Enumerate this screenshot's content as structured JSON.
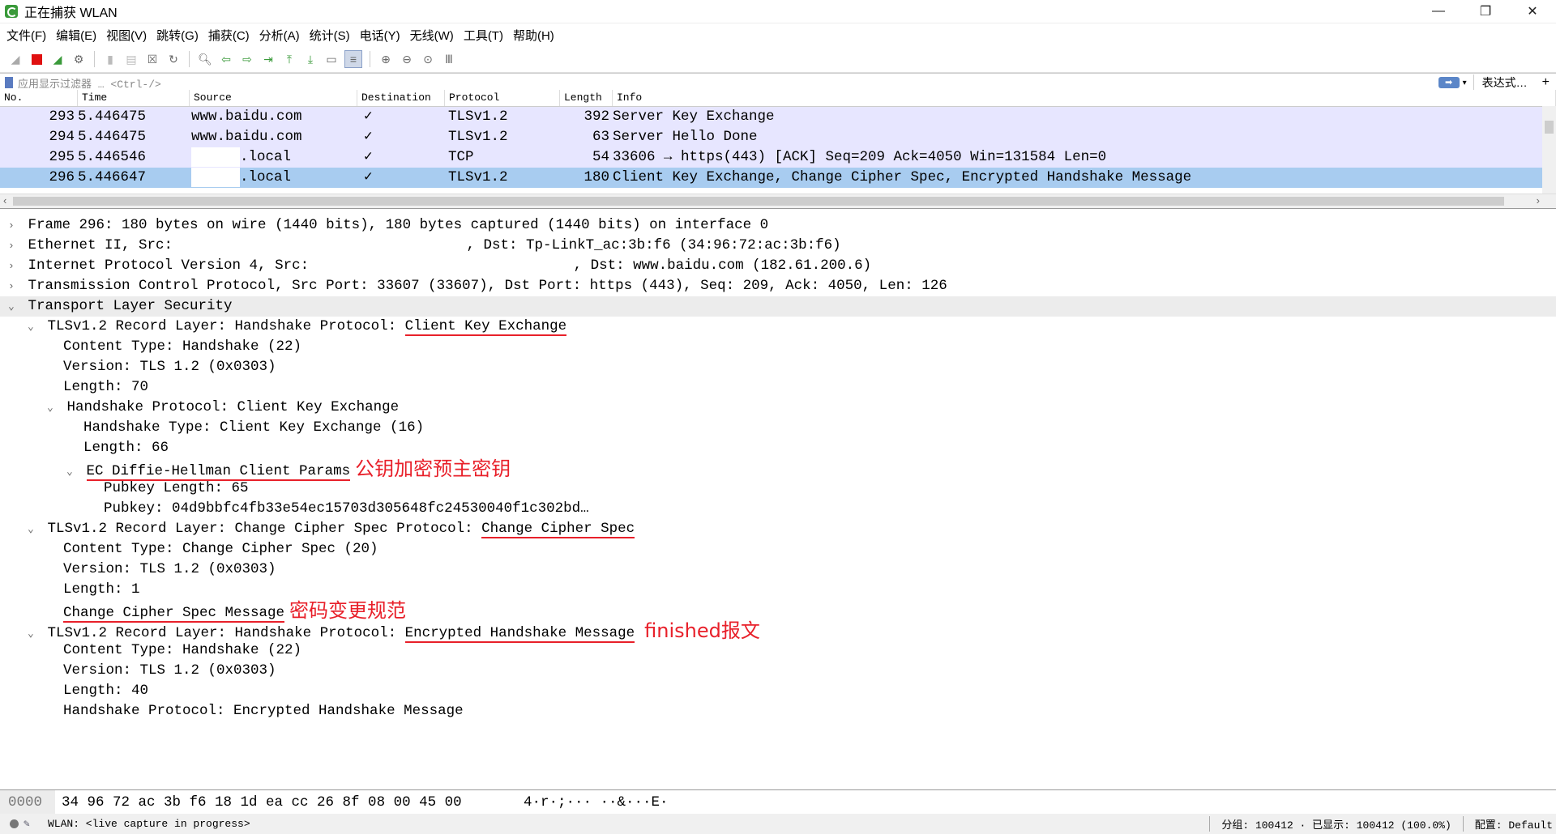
{
  "window": {
    "title": "正在捕获 WLAN",
    "minimize": "—",
    "restore": "❐",
    "close": "✕"
  },
  "menu": [
    "文件(F)",
    "编辑(E)",
    "视图(V)",
    "跳转(G)",
    "捕获(C)",
    "分析(A)",
    "统计(S)",
    "电话(Y)",
    "无线(W)",
    "工具(T)",
    "帮助(H)"
  ],
  "filter": {
    "placeholder": "应用显示过滤器 … <Ctrl-/>",
    "expression_label": "表达式…",
    "plus": "+"
  },
  "packet_list": {
    "headers": [
      "No.",
      "Time",
      "Source",
      "Destination",
      "Protocol",
      "Length",
      "Info"
    ],
    "rows": [
      {
        "no": "293",
        "time": "5.446475",
        "src": "www.baidu.com",
        "dst": "✓",
        "proto": "TLSv1.2",
        "len": "392",
        "info": "Server Key Exchange"
      },
      {
        "no": "294",
        "time": "5.446475",
        "src": "www.baidu.com",
        "dst": "✓",
        "proto": "TLSv1.2",
        "len": "63",
        "info": "Server Hello Done"
      },
      {
        "no": "295",
        "time": "5.446546",
        "src": ".local",
        "dst": "✓",
        "proto": "TCP",
        "len": "54",
        "info": "33606 → https(443) [ACK] Seq=209 Ack=4050 Win=131584 Len=0"
      },
      {
        "no": "296",
        "time": "5.446647",
        "src": ".local",
        "dst": "✓",
        "proto": "TLSv1.2",
        "len": "180",
        "info": "Client Key Exchange, Change Cipher Spec, Encrypted Handshake Message"
      }
    ]
  },
  "details": {
    "frame": "Frame 296: 180 bytes on wire (1440 bits), 180 bytes captured (1440 bits) on interface 0",
    "eth_a": "Ethernet II, Src: ",
    "eth_b": ", Dst: Tp-LinkT_ac:3b:f6 (34:96:72:ac:3b:f6)",
    "ip_a": "Internet Protocol Version 4, Src: ",
    "ip_b": ", Dst: www.baidu.com (182.61.200.6)",
    "tcp": "Transmission Control Protocol, Src Port: 33607 (33607), Dst Port: https (443), Seq: 209, Ack: 4050, Len: 126",
    "tls": "Transport Layer Security",
    "rec1_a": "TLSv1.2 Record Layer: Handshake Protocol: ",
    "rec1_b": "Client Key Exchange",
    "rec1_ct": "Content Type: Handshake (22)",
    "rec1_ver": "Version: TLS 1.2 (0x0303)",
    "rec1_len": "Length: 70",
    "hs": "Handshake Protocol: Client Key Exchange",
    "hs_type": "Handshake Type: Client Key Exchange (16)",
    "hs_len": "Length: 66",
    "ecdh": "EC Diffie-Hellman Client Params",
    "ecdh_note": "公钥加密预主密钥",
    "pk_len": "Pubkey Length: 65",
    "pk": "Pubkey: 04d9bbfc4fb33e54ec15703d305648fc24530040f1c302bd…",
    "rec2_a": "TLSv1.2 Record Layer: Change Cipher Spec Protocol: ",
    "rec2_b": "Change Cipher Spec",
    "rec2_ct": "Content Type: Change Cipher Spec (20)",
    "rec2_ver": "Version: TLS 1.2 (0x0303)",
    "rec2_len": "Length: 1",
    "ccs_msg": "Change Cipher Spec Message",
    "ccs_note": "密码变更规范",
    "rec3_a": "TLSv1.2 Record Layer: Handshake Protocol: ",
    "rec3_b": "Encrypted Handshake Message",
    "rec3_note": "finished报文",
    "rec3_ct": "Content Type: Handshake (22)",
    "rec3_ver": "Version: TLS 1.2 (0x0303)",
    "rec3_len": "Length: 40",
    "rec3_hs": "Handshake Protocol: Encrypted Handshake Message"
  },
  "bytes": {
    "offset": "0000",
    "hex": "34 96 72 ac 3b f6 18 1d  ea cc 26 8f 08 00 45 00",
    "ascii": "4·r·;···  ··&···E·"
  },
  "status": {
    "live": "WLAN: <live capture in progress>",
    "packets": "分组: 100412 · 已显示: 100412 (100.0%)",
    "profile": "配置: Default"
  }
}
